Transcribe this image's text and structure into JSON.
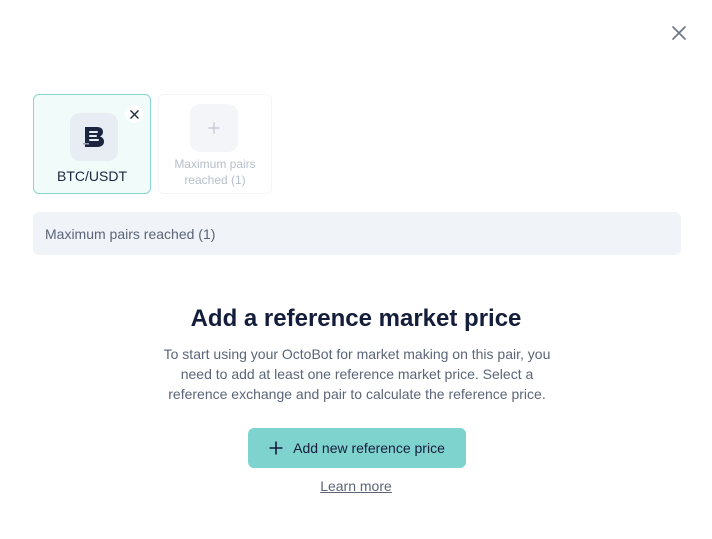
{
  "dialog": {
    "close_icon": "close-icon"
  },
  "pairs": {
    "selected": {
      "label": "BTC/USDT",
      "logo_icon": "exchange-logo-icon",
      "remove_icon": "close-icon"
    },
    "add_slot": {
      "icon": "plus-icon",
      "label": "Maximum pairs reached (1)"
    }
  },
  "notice": {
    "text": "Maximum pairs reached (1)"
  },
  "empty_state": {
    "title": "Add a reference market price",
    "description": "To start using your OctoBot for market making on this pair, you need to add at least one reference market price. Select a reference exchange and pair to calculate the reference price.",
    "button_label": "Add new reference price",
    "button_icon": "plus-icon",
    "link_label": "Learn more"
  },
  "colors": {
    "accent": "#7fd3cf",
    "selected_border": "#88d5cf",
    "heading_text": "#141d3a",
    "muted_text": "#5b6577"
  }
}
